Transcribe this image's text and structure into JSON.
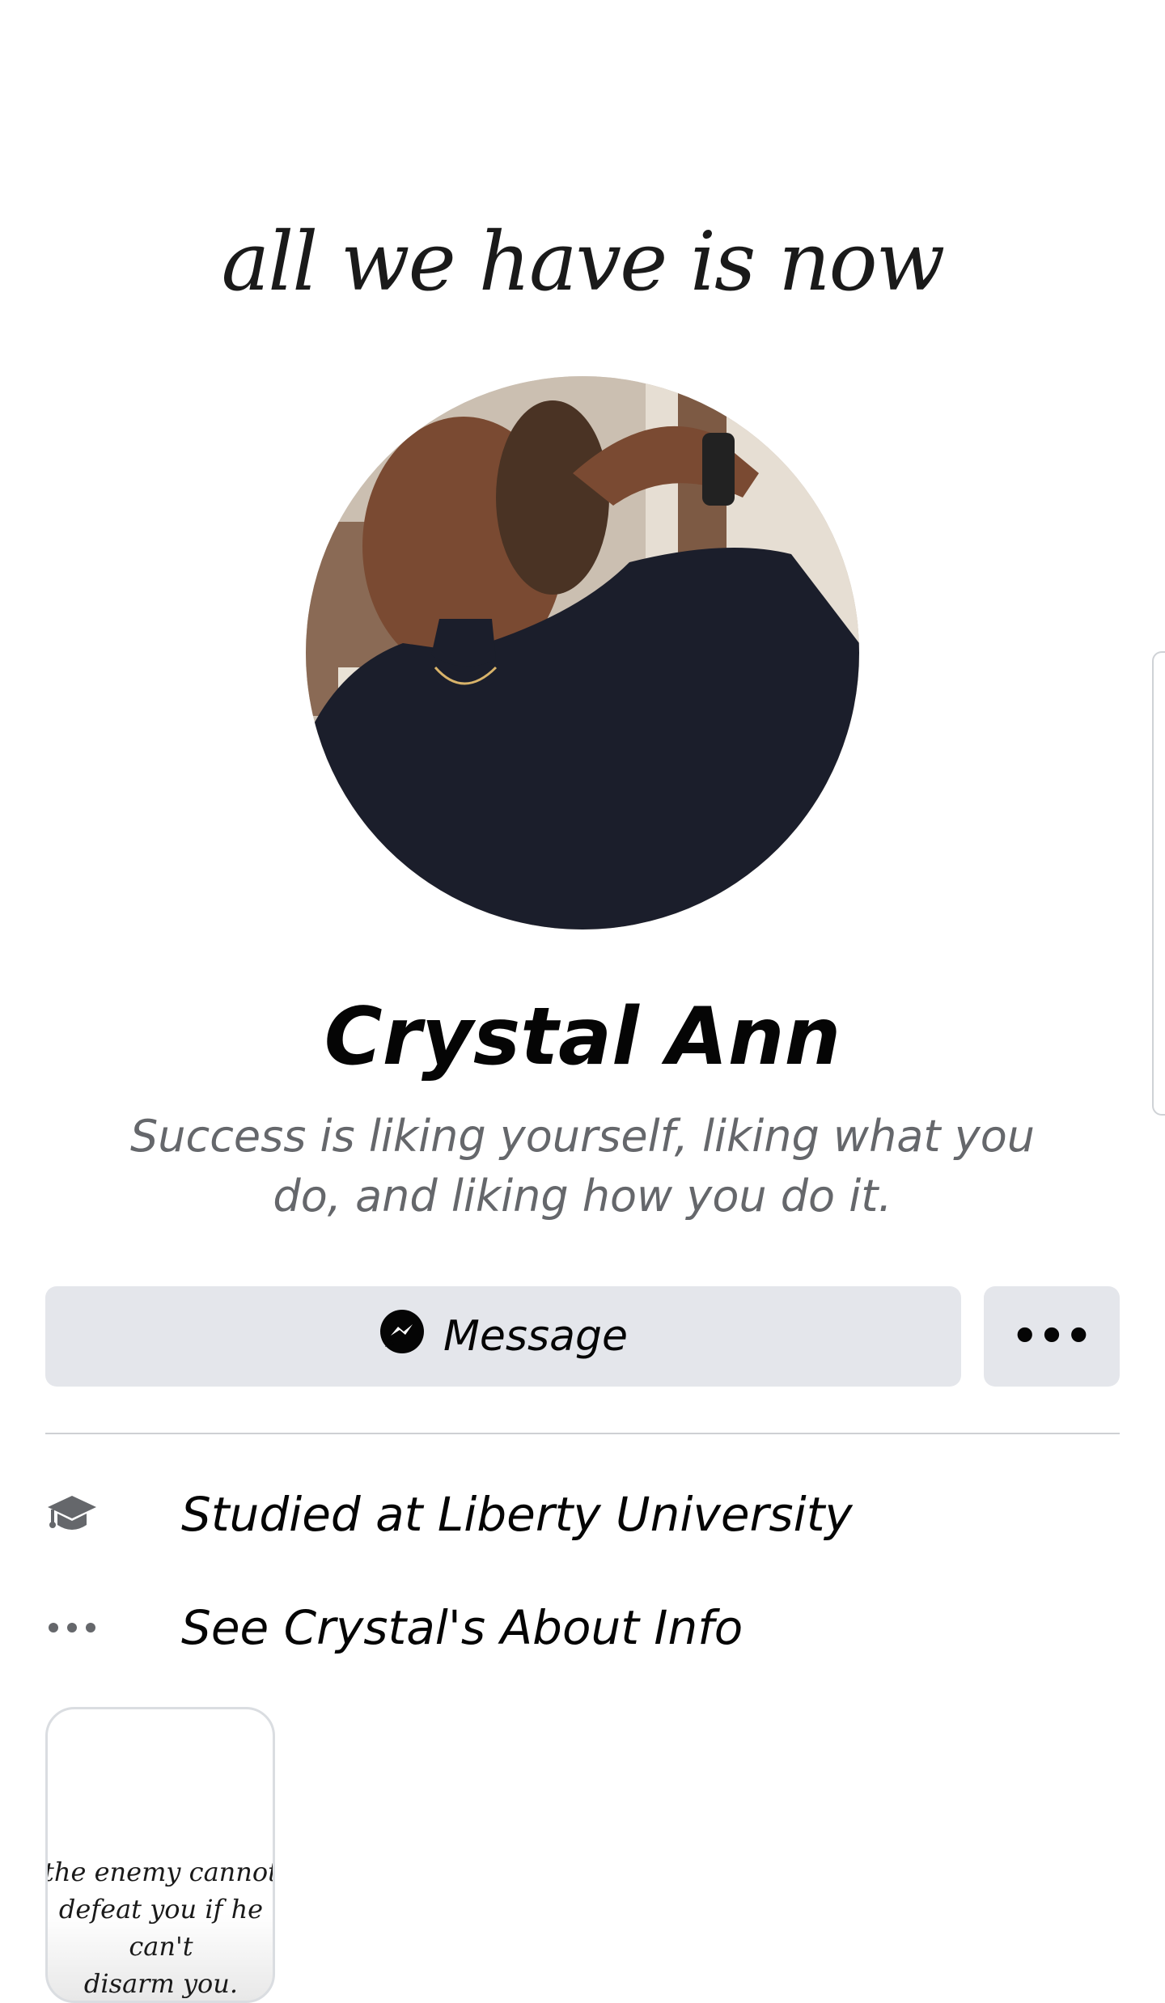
{
  "cover": {
    "text": "all we have is now"
  },
  "profile": {
    "name": "Crystal Ann",
    "bio": "Success is liking yourself, liking what you do, and liking how you do it."
  },
  "actions": {
    "message_label": "Message",
    "more_label": "•••"
  },
  "info": {
    "education": "Studied at Liberty University",
    "about_link": "See Crystal's About Info"
  },
  "story": {
    "text_line1": "the enemy cannot",
    "text_line2": "defeat you if he can't",
    "text_line3": "disarm you."
  },
  "colors": {
    "button_bg": "#e4e6eb",
    "secondary_text": "#65676b",
    "primary_text": "#050505",
    "divider": "#ced0d4"
  },
  "icons": {
    "message": "messenger-icon",
    "more": "more-dots-icon",
    "education": "graduation-cap-icon",
    "about": "ellipsis-icon"
  }
}
